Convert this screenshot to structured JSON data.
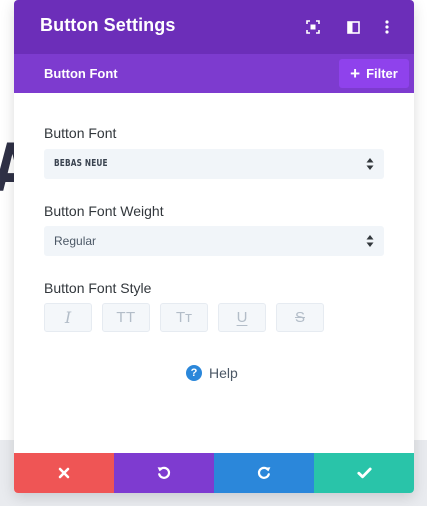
{
  "modal": {
    "title": "Button Settings",
    "header_icons": [
      "fullscreen-icon",
      "split-view-icon",
      "more-vertical-icon"
    ]
  },
  "toggle_bar": {
    "title": "Button Font",
    "filter_label": "Filter",
    "filter_icon": "plus-icon"
  },
  "fields": {
    "font": {
      "label": "Button Font",
      "value": "BEBAS NEUE"
    },
    "weight": {
      "label": "Button Font Weight",
      "value": "Regular"
    },
    "style": {
      "label": "Button Font Style",
      "buttons": [
        {
          "name": "italic",
          "icon": "italic-icon",
          "glyph": "I"
        },
        {
          "name": "uppercase",
          "icon": "uppercase-icon",
          "glyph": "TT"
        },
        {
          "name": "capitalize",
          "icon": "capitalize-icon",
          "glyph": "Tт"
        },
        {
          "name": "underline",
          "icon": "underline-icon",
          "glyph": "U"
        },
        {
          "name": "strikethrough",
          "icon": "strikethrough-icon",
          "glyph": "S"
        }
      ]
    }
  },
  "help": {
    "label": "Help",
    "icon": "help-icon",
    "glyph": "?"
  },
  "background": {
    "glyph": "A"
  },
  "footer": {
    "buttons": [
      {
        "name": "discard",
        "icon": "close-icon",
        "color": "#ef5555"
      },
      {
        "name": "undo",
        "icon": "undo-icon",
        "color": "#7e3bd0"
      },
      {
        "name": "redo",
        "icon": "redo-icon",
        "color": "#2b87da"
      },
      {
        "name": "save",
        "icon": "check-icon",
        "color": "#29c4a9"
      }
    ]
  },
  "colors": {
    "header": "#6c2eb9",
    "subbar": "#7d3bcf",
    "filter_button": "#8f42ec",
    "help_icon": "#2b87da"
  }
}
